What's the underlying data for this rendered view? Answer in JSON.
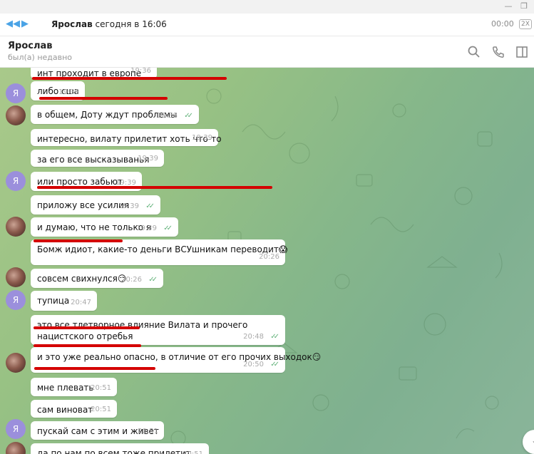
{
  "player": {
    "track_name": "Ярослав",
    "track_date": "сегодня в 16:06",
    "time": "00:00",
    "speed": "2X"
  },
  "chat_header": {
    "name": "Ярослав",
    "status": "был(а) недавно"
  },
  "avatar_letter": "Я",
  "messages": [
    {
      "text": "инт проходит в европе",
      "time": "19:36",
      "read": false
    },
    {
      "text": "либо сша",
      "time": "19:36",
      "read": false
    },
    {
      "text": "в общем, Доту ждут проблемы",
      "time": "19:38",
      "read": true
    },
    {
      "text": "интересно, вилату прилетит хоть что-то",
      "time": "19:39",
      "read": false
    },
    {
      "text": "за его все высказыванья",
      "time": "19:39",
      "read": false
    },
    {
      "text": "или просто забьют",
      "time": "19:39",
      "read": false
    },
    {
      "text": "приложу все усилия",
      "time": "19:39",
      "read": true
    },
    {
      "text": "и думаю, что не только я",
      "time": "19:39",
      "read": true
    },
    {
      "text": "Бомж идиот, какие-то деньги ВСУшникам переводит😱",
      "time": "20:26",
      "read": false
    },
    {
      "text": "совсем свихнулся😏",
      "time": "20:26",
      "read": true
    },
    {
      "text": "тупица",
      "time": "20:47",
      "read": false
    },
    {
      "text": "это все тлетворное влияние Вилата и прочего нацистского отребья",
      "time": "20:48",
      "read": true
    },
    {
      "text": "и это уже реально опасно, в отличие от его прочих выходок😏",
      "time": "20:50",
      "read": true
    },
    {
      "text": "мне плевать",
      "time": "20:51",
      "read": false
    },
    {
      "text": "сам виноват",
      "time": "20:51",
      "read": false
    },
    {
      "text": "пускай сам с этим и живет",
      "time": "20:51",
      "read": false
    },
    {
      "text": "да по нам по всем тоже прилетит",
      "time": "20:51",
      "read": false
    }
  ],
  "checkmarks": "✓✓",
  "colors": {
    "accent": "#4aa3e6",
    "read_check": "#62b27a",
    "highlight_underline": "#d40000",
    "avatar_letter_bg": "#9b8fdc"
  },
  "icons": [
    "rewind-icon",
    "play-icon",
    "search-icon",
    "phone-icon",
    "sidebar-icon",
    "chevron-down-icon"
  ]
}
